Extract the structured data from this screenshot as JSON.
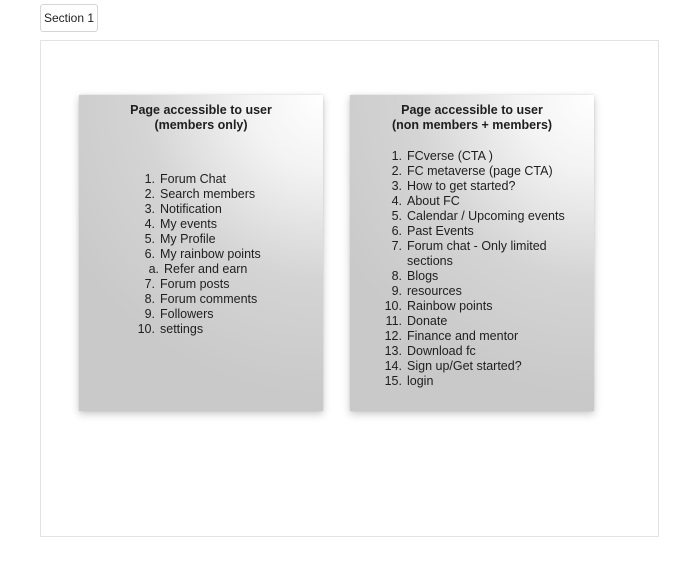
{
  "section_tab": {
    "label": "Section 1"
  },
  "cards": {
    "members": {
      "title": "Page accessible to user\n(members only)",
      "items": [
        {
          "num": "1.",
          "label": "Forum Chat"
        },
        {
          "num": "2.",
          "label": "Search members"
        },
        {
          "num": "3.",
          "label": "Notification"
        },
        {
          "num": "4.",
          "label": "My events"
        },
        {
          "num": "5.",
          "label": "My Profile"
        },
        {
          "num": "6.",
          "label": "My rainbow points"
        },
        {
          "num": "a.",
          "label": "Refer and earn"
        },
        {
          "num": "7.",
          "label": "Forum posts"
        },
        {
          "num": "8.",
          "label": "Forum comments"
        },
        {
          "num": "9.",
          "label": "Followers"
        },
        {
          "num": "10.",
          "label": "settings"
        }
      ]
    },
    "public": {
      "title": "Page accessible to user\n(non members + members)",
      "items": [
        {
          "num": "1.",
          "label": "FCverse (CTA )"
        },
        {
          "num": "2.",
          "label": "FC metaverse (page CTA)"
        },
        {
          "num": "3.",
          "label": "How to get started?"
        },
        {
          "num": "4.",
          "label": "About FC"
        },
        {
          "num": "5.",
          "label": "Calendar / Upcoming events"
        },
        {
          "num": "6.",
          "label": "Past Events"
        },
        {
          "num": "7.",
          "label": "Forum chat - Only limited sections"
        },
        {
          "num": "8.",
          "label": "Blogs"
        },
        {
          "num": "9.",
          "label": "resources"
        },
        {
          "num": "10.",
          "label": "Rainbow points"
        },
        {
          "num": "11.",
          "label": "Donate"
        },
        {
          "num": "12.",
          "label": "Finance and mentor"
        },
        {
          "num": "13.",
          "label": "Download fc"
        },
        {
          "num": "14.",
          "label": "Sign up/Get started?"
        },
        {
          "num": "15.",
          "label": "login"
        }
      ]
    }
  }
}
